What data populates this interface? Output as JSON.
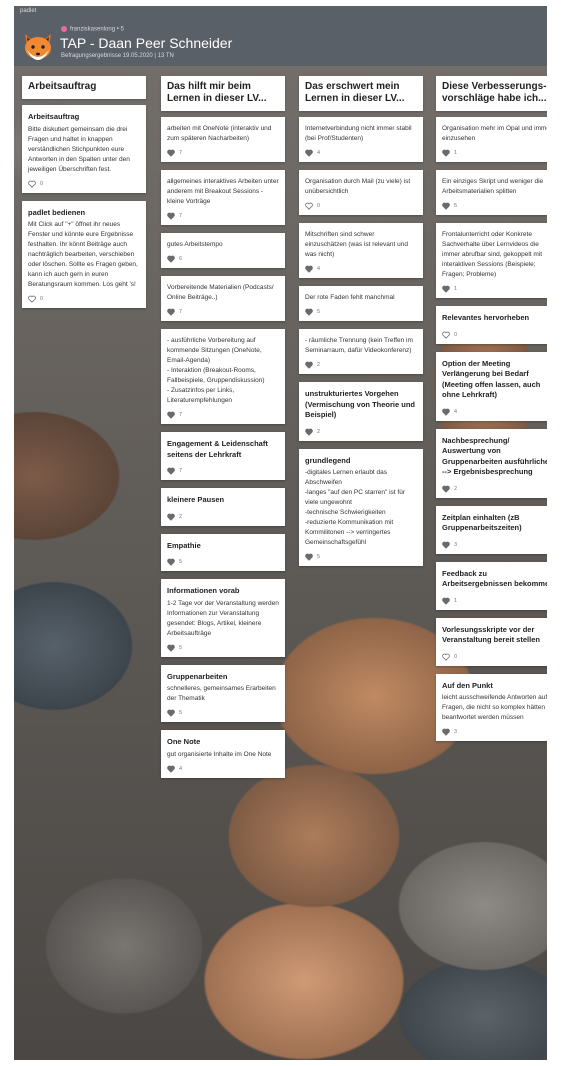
{
  "header": {
    "app_label": "padlet",
    "meta": "franziskasenlong",
    "meta_badge": "5",
    "title": "TAP - Daan Peer Schneider",
    "subtitle": "Befragungsergebnisse 19.05.2020 | 13 TN"
  },
  "colors": {
    "header_bg": "#5a6068",
    "card_bg": "#ffffff",
    "heart": "#6b6b6b"
  },
  "columns": [
    {
      "title": "Arbeitsauftrag",
      "cards": [
        {
          "title": "Arbeitsauftrag",
          "text": "Bitte diskutiert gemeinsam die drei Fragen und haltet in knappen verständlichen Stichpunkten eure Antworten in den Spalten unter den jeweiligen Überschriften fest.",
          "likes": "0",
          "liked": false
        },
        {
          "title": "padlet bedienen",
          "text": "Mit Click auf \"+\" öffnet ihr neues Fenster und könnte eure Ergebnisse festhalten. Ihr könnt Beiträge auch nachträglich bearbeiten, verschieben oder löschen. Sollte es Fragen geben, kann ich auch gern in euren Beratungsraum kommen. Los geht 's!",
          "likes": "0",
          "liked": false
        }
      ]
    },
    {
      "title": "Das hilft mir beim Lernen in dieser LV...",
      "cards": [
        {
          "title": "",
          "text": "arbeiten mit OneNote (interaktiv und zum späteren Nacharbeiten)",
          "likes": "7",
          "liked": true
        },
        {
          "title": "",
          "text": "allgemeines interaktives Arbeiten unter anderem mit Breakout Sessions - kleine Vorträge",
          "likes": "7",
          "liked": true
        },
        {
          "title": "",
          "text": "gutes Arbeitstempo",
          "likes": "6",
          "liked": true
        },
        {
          "title": "",
          "text": "Vorbereitende Materialien (Podcasts/ Online Beiträge..)",
          "likes": "7",
          "liked": true
        },
        {
          "title": "",
          "text": "- ausführliche Vorbereitung auf kommende Sitzungen (OneNote, Email-Agenda)\n- Interaktion (Breakout-Rooms, Fallbeispiele, Gruppendiskussion)\n- Zusatzinfos per Links, Literaturempfehlungen",
          "likes": "7",
          "liked": true
        },
        {
          "title": "Engagement & Leidenschaft seitens der Lehrkraft",
          "text": "",
          "likes": "7",
          "liked": true
        },
        {
          "title": "kleinere Pausen",
          "text": "",
          "likes": "2",
          "liked": true
        },
        {
          "title": "Empathie",
          "text": "",
          "likes": "5",
          "liked": true
        },
        {
          "title": "Informationen vorab",
          "text": "1-2 Tage vor der Veranstaltung werden Informationen zur Veranstaltung gesendet: Blogs, Artikel, kleinere Arbeitsaufträge",
          "likes": "5",
          "liked": true
        },
        {
          "title": "Gruppenarbeiten",
          "text": "schnelleres, gemeinsames Erarbeiten der Thematik",
          "likes": "5",
          "liked": true
        },
        {
          "title": "One Note",
          "text": "gut organisierte Inhalte im One Note",
          "likes": "4",
          "liked": true
        }
      ]
    },
    {
      "title": "Das erschwert mein Lernen in dieser LV...",
      "cards": [
        {
          "title": "",
          "text": "Internetverbindung nicht immer stabil (bei Prof/Studenten)",
          "likes": "4",
          "liked": true
        },
        {
          "title": "",
          "text": "Organisation durch Mail (zu viele) ist unübersichtlich",
          "likes": "0",
          "liked": false
        },
        {
          "title": "",
          "text": "Mitschriften sind schwer einzuschätzen (was ist relevant und was nicht)",
          "likes": "4",
          "liked": true
        },
        {
          "title": "",
          "text": "Der rote Faden fehlt manchmal",
          "likes": "5",
          "liked": true
        },
        {
          "title": "",
          "text": "- räumliche Trennung (kein Treffen im Seminarraum, dafür Videokonferenz)",
          "likes": "2",
          "liked": true
        },
        {
          "title": "unstrukturiertes Vorgehen (Vermischung von Theorie und Beispiel)",
          "text": "",
          "likes": "2",
          "liked": true
        },
        {
          "title": "grundlegend",
          "text": "-digitales Lernen erlaubt das Abschweifen\n-langes \"auf den PC starren\" ist für viele ungewohnt\n-technische Schwierigkeiten\n-reduzierte Kommunikation mit Kommilitonen --> verringertes Gemeinschaftsgefühl",
          "likes": "5",
          "liked": true
        }
      ]
    },
    {
      "title": "Diese Verbesserungs-vorschläge habe ich...",
      "cards": [
        {
          "title": "",
          "text": "Organisation mehr im Opal und immer einzusehen",
          "likes": "1",
          "liked": true
        },
        {
          "title": "",
          "text": "Ein einziges Skript und weniger die Arbeitsmaterialien splitten",
          "likes": "5",
          "liked": true
        },
        {
          "title": "",
          "text": "Frontalunterricht oder Konkrete Sachverhalte über Lernvideos die immer abrufbar sind, gekoppelt mit interaktiven Sessions (Beispiele; Fragen; Probleme)",
          "likes": "1",
          "liked": true
        },
        {
          "title": "Relevantes hervorheben",
          "text": "",
          "likes": "0",
          "liked": false
        },
        {
          "title": "Option der Meeting Verlängerung bei Bedarf (Meeting offen lassen, auch ohne Lehrkraft)",
          "text": "",
          "likes": "4",
          "liked": true
        },
        {
          "title": "Nachbesprechung/ Auswertung von Gruppenarbeiten ausführlicher --> Ergebnisbesprechung",
          "text": "",
          "likes": "2",
          "liked": true
        },
        {
          "title": "Zeitplan einhalten (zB Gruppenarbeitszeiten)",
          "text": "",
          "likes": "3",
          "liked": true
        },
        {
          "title": "Feedback zu Arbeitsergebnissen bekommen",
          "text": "",
          "likes": "1",
          "liked": true
        },
        {
          "title": "Vorlesungsskripte vor der Veranstaltung bereit stellen",
          "text": "",
          "likes": "0",
          "liked": false
        },
        {
          "title": "Auf den Punkt",
          "text": "leicht ausschweifende Antworten auf Fragen, die nicht so komplex hätten beantwortet werden müssen",
          "likes": "3",
          "liked": true
        }
      ]
    }
  ]
}
